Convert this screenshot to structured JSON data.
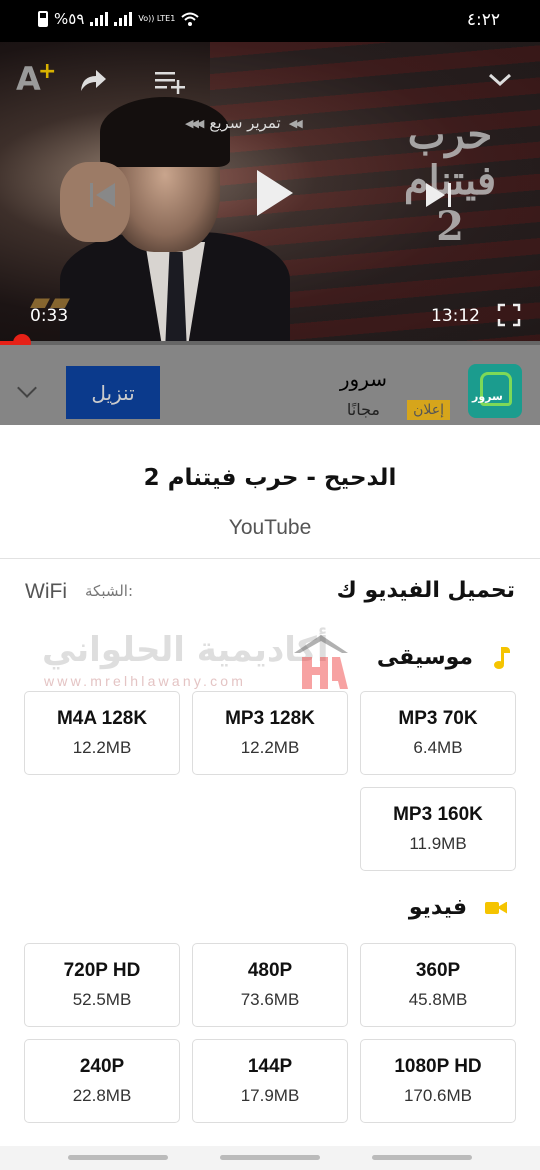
{
  "status_bar": {
    "time": "٤:٢٢",
    "battery": "%٥٩",
    "lte": "Vo)) LTE1"
  },
  "player": {
    "overlay_title": "حرب فيتنام 2",
    "skip_hint": "تمرير سريع",
    "current_time": "0:33",
    "duration": "13:12",
    "progress": 0.04
  },
  "ad": {
    "app_name": "سرور",
    "price": "مجانًا",
    "badge": "إعلان",
    "icon_label": "سرور",
    "install_label": "تنزيل"
  },
  "sheet": {
    "title": "الدحيح - حرب فيتنام 2",
    "source": "YouTube",
    "download_as": "تحميل الفيديو ك",
    "network_label": "الشبكة:",
    "network_value": "WiFi",
    "watermark_text": "أكاديمية الحلواني",
    "watermark_url": "www.mrelhlawany.com",
    "music_section": "موسيقى",
    "video_section": "فيديو",
    "music_options": [
      {
        "quality": "MP3 70K",
        "size": "6.4MB"
      },
      {
        "quality": "MP3 128K",
        "size": "12.2MB"
      },
      {
        "quality": "M4A 128K",
        "size": "12.2MB"
      },
      {
        "quality": "MP3 160K",
        "size": "11.9MB"
      }
    ],
    "video_options": [
      {
        "quality": "360P",
        "size": "45.8MB"
      },
      {
        "quality": "480P",
        "size": "73.6MB"
      },
      {
        "quality": "720P HD",
        "size": "52.5MB"
      },
      {
        "quality": "1080P HD",
        "size": "170.6MB"
      },
      {
        "quality": "144P",
        "size": "17.9MB"
      },
      {
        "quality": "240P",
        "size": "22.8MB"
      }
    ]
  }
}
